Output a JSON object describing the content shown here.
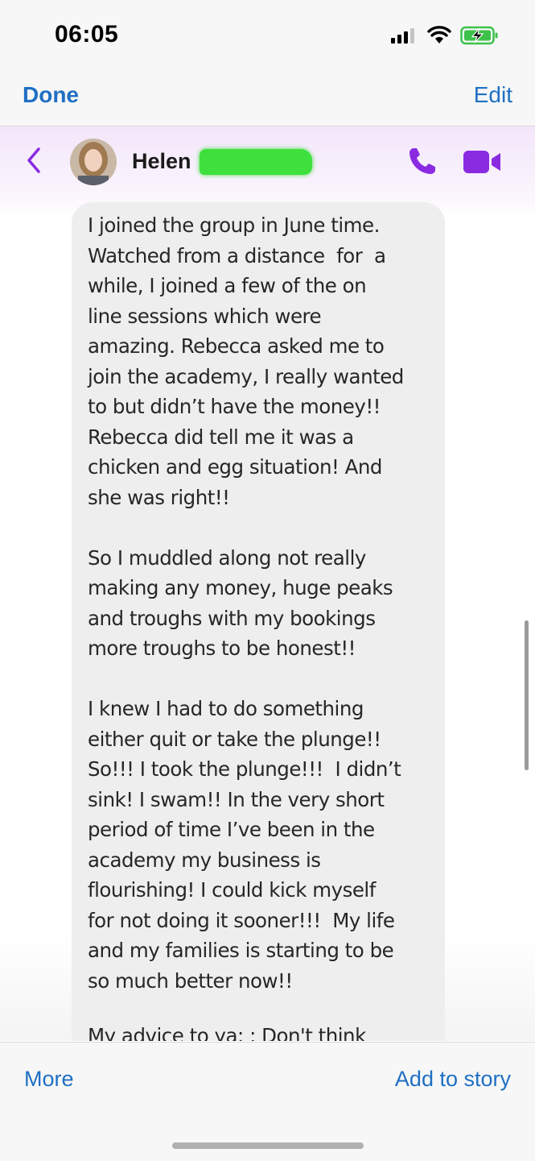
{
  "status_bar": {
    "time": "06:05",
    "icons": [
      "cellular-signal-icon",
      "wifi-icon",
      "battery-charging-icon"
    ],
    "battery_color": "#3cc24a"
  },
  "viewer_bar": {
    "done_label": "Done",
    "edit_label": "Edit",
    "accent": "#1f6fc4"
  },
  "chat_header": {
    "contact_name": "Helen",
    "icons": [
      "back-chevron-icon",
      "phone-icon",
      "video-camera-icon"
    ],
    "accent": "#8a2be2",
    "redaction_color": "#3ee03e"
  },
  "message": {
    "lines": [
      "I joined the group in June time.",
      "Watched from a distance  for  a",
      "while, I joined a few of the on",
      "line sessions which were",
      "amazing. Rebecca asked me to",
      "join the academy, I really wanted",
      "to but didn’t have the money!!",
      "Rebecca did tell me it was a",
      "chicken and egg situation! And",
      "she was right!!",
      "",
      "So I muddled along not really",
      "making any money, huge peaks",
      "and troughs with my bookings",
      "more troughs to be honest!!",
      "",
      "I knew I had to do something",
      "either quit or take the plunge!!",
      "So!!! I took the plunge!!!  I didn’t",
      "sink! I swam!! In the very short",
      "period of time I’ve been in the",
      "academy my business is",
      "flourishing! I could kick myself",
      "for not doing it sooner!!!  My life",
      "and my families is starting to be",
      "so much better now!!"
    ],
    "clipped_line": "My advice to ya: ; Don't think"
  },
  "bottom_bar": {
    "more_label": "More",
    "story_label": "Add to story"
  }
}
